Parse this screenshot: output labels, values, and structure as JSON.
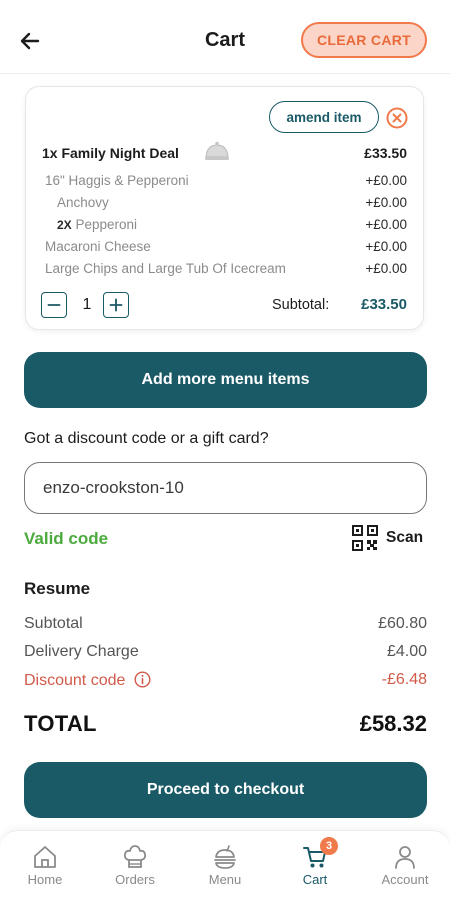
{
  "header": {
    "title": "Cart",
    "clear_label": "CLEAR CART"
  },
  "cart_item": {
    "amend_label": "amend item",
    "name": "1x Family Night Deal",
    "price": "£33.50",
    "options": [
      {
        "prefix": "",
        "label": "16\" Haggis & Pepperoni",
        "price": "+£0.00"
      },
      {
        "prefix": "",
        "label": "Anchovy",
        "price": "+£0.00"
      },
      {
        "prefix": "2X",
        "label": "Pepperoni",
        "price": "+£0.00"
      },
      {
        "prefix": "",
        "label": "Macaroni Cheese",
        "price": "+£0.00"
      },
      {
        "prefix": "",
        "label": "Large Chips and Large Tub Of Icecream",
        "price": "+£0.00"
      }
    ],
    "quantity": "1",
    "subtotal_label": "Subtotal:",
    "subtotal_value": "£33.50"
  },
  "add_more_label": "Add more menu items",
  "discount": {
    "question": "Got a discount code or a gift card?",
    "code_value": "enzo-crookston-10",
    "status": "Valid code",
    "scan_label": "Scan"
  },
  "resume": {
    "title": "Resume",
    "subtotal_label": "Subtotal",
    "subtotal_value": "£60.80",
    "delivery_label": "Delivery Charge",
    "delivery_value": "£4.00",
    "discount_label": "Discount code",
    "discount_value": "-£6.48",
    "total_label": "TOTAL",
    "total_value": "£58.32"
  },
  "checkout_label": "Proceed to checkout",
  "nav": {
    "items": [
      {
        "label": "Home",
        "icon": "home-icon"
      },
      {
        "label": "Orders",
        "icon": "chef-hat-icon"
      },
      {
        "label": "Menu",
        "icon": "menu-icon"
      },
      {
        "label": "Cart",
        "icon": "cart-icon",
        "badge": "3"
      },
      {
        "label": "Account",
        "icon": "account-icon"
      }
    ]
  },
  "colors": {
    "primary": "#1a5a66",
    "accent": "#f07a4b",
    "valid": "#4caa3e",
    "discount": "#d25a4a"
  }
}
